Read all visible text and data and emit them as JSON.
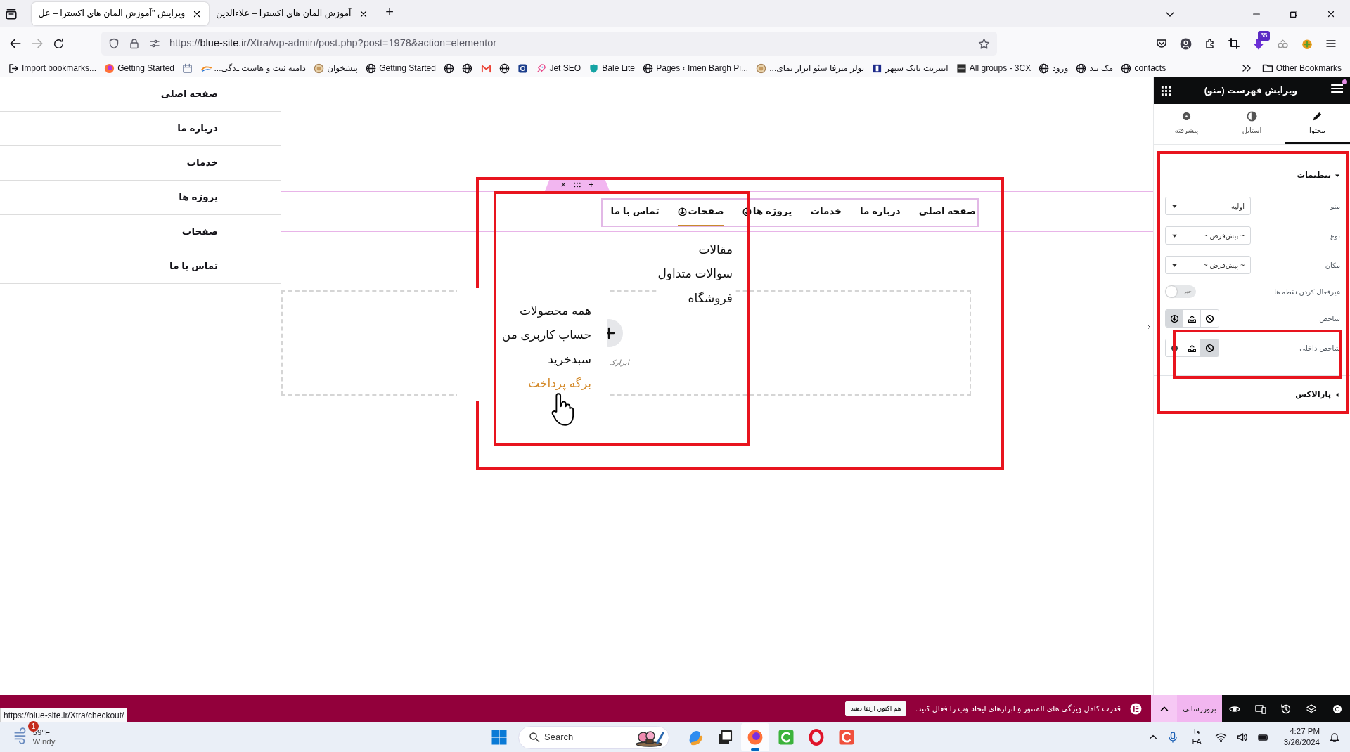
{
  "browser": {
    "tabs": [
      {
        "title": "آموزش المان های اکسترا – علاءالدین",
        "selected": false
      },
      {
        "title": "ویرایش \"آموزش المان های اکسترا – عل",
        "selected": true
      }
    ],
    "new_tab": "+",
    "url": "https://**blue-site.ir**/Xtra/wp-admin/post.php?post=1978&action=elementor",
    "extension_badge": "35",
    "bookmarks": [
      {
        "kind": "globe",
        "label": "contacts"
      },
      {
        "kind": "globe",
        "label": "مک نید"
      },
      {
        "kind": "globe",
        "label": "ورود"
      },
      {
        "kind": "cx",
        "label": "All groups - 3CX"
      },
      {
        "kind": "bank",
        "label": "اینترنت بانک سپهر"
      },
      {
        "kind": "lion",
        "label": "تولز میزفا سئو ابزار نمای..."
      },
      {
        "kind": "globe",
        "label": "Pages ‹ Imen Bargh Pi..."
      },
      {
        "kind": "shield",
        "label": "Bale Lite"
      },
      {
        "kind": "rocket",
        "label": "Jet SEO"
      },
      {
        "kind": "square"
      },
      {
        "kind": "globe"
      },
      {
        "kind": "mail"
      },
      {
        "kind": "globe"
      },
      {
        "kind": "globe"
      },
      {
        "kind": "globe",
        "label": "Getting Started"
      },
      {
        "kind": "lion",
        "label": "پیشخوان"
      },
      {
        "kind": "swoosh",
        "label": "دامنه ثبت و هاست ـدگی..."
      },
      {
        "kind": "calendar"
      },
      {
        "kind": "fox",
        "label": "Getting Started"
      },
      {
        "kind": "import",
        "label": "Import bookmarks..."
      }
    ],
    "other_bookmarks": "Other Bookmarks"
  },
  "page_menu": [
    "صفحه اصلی",
    "درباره ما",
    "خدمات",
    "پروژه ها",
    "صفحات",
    "تماس با ما"
  ],
  "canvas": {
    "handle": {
      "close": "×",
      "add": "+"
    },
    "nav": [
      {
        "label": "صفحه اصلی",
        "dropdown": false,
        "selected": false
      },
      {
        "label": "درباره ما",
        "dropdown": false,
        "selected": false
      },
      {
        "label": "خدمات",
        "dropdown": false,
        "selected": false
      },
      {
        "label": "پروژه ها",
        "dropdown": true,
        "selected": false
      },
      {
        "label": "صفحات",
        "dropdown": true,
        "selected": true,
        "expanded": true,
        "children": [
          {
            "label": "مقالات",
            "hovered": false
          },
          {
            "label": "سوالات متداول",
            "hovered": false
          },
          {
            "label": "فروشگاه",
            "hovered": false,
            "expanded": true,
            "children": [
              {
                "label": "همه محصولات",
                "hovered": false
              },
              {
                "label": "حساب کاربری من",
                "hovered": false
              },
              {
                "label": "سبدخرید",
                "hovered": false
              },
              {
                "label": "برگه پرداخت",
                "hovered": true
              }
            ]
          }
        ]
      },
      {
        "label": "تماس با ما",
        "dropdown": false,
        "selected": false
      }
    ],
    "empty_section": {
      "add_label": "ابزارک"
    }
  },
  "panel": {
    "title": "ویرایش فهرست (منو)",
    "notification": true,
    "tabs": [
      {
        "label": "محتوا",
        "kind": "pencil",
        "selected": true
      },
      {
        "label": "استایل",
        "kind": "contrast",
        "selected": false
      },
      {
        "label": "پیشرفته",
        "kind": "gear",
        "selected": false
      }
    ],
    "sections": [
      {
        "title": "تنظیمات",
        "expanded": true,
        "controls": [
          {
            "kind": "select",
            "label": "منو",
            "value": "اولیه"
          },
          {
            "kind": "select",
            "label": "نوع",
            "value": "~ پیش‌فرض ~"
          },
          {
            "kind": "select",
            "label": "مکان",
            "value": "~ پیش‌فرض ~"
          },
          {
            "kind": "toggle",
            "label": "غیرفعال کردن نقطه ها",
            "on": false,
            "off_text": "خیر"
          },
          {
            "kind": "choose",
            "label": "شاخص",
            "options": [
              {
                "kind": "arrow",
                "selected": true
              },
              {
                "kind": "upload",
                "selected": false
              },
              {
                "kind": "none",
                "selected": false
              }
            ]
          },
          {
            "kind": "choose",
            "label": "شاخص داخلی",
            "options": [
              {
                "kind": "dot",
                "selected": false
              },
              {
                "kind": "upload",
                "selected": false
              },
              {
                "kind": "none",
                "selected": true
              }
            ]
          }
        ]
      },
      {
        "title": "پارالاکس",
        "expanded": false
      }
    ]
  },
  "editor_bar": {
    "update_button": "بروزرسانی",
    "promo_text": "قدرت کامل ویژگی های المنتور و ابزارهای ایجاد وب را فعال کنید.",
    "promo_button": "هم اکنون ارتقا دهید"
  },
  "status_url": "https://blue-site.ir/Xtra/checkout/",
  "taskbar": {
    "weather_badge": "1",
    "temperature": "59°F",
    "condition": "Windy",
    "search": "Search",
    "apps": [
      {
        "kind": "copilot",
        "active": false
      },
      {
        "kind": "windows",
        "active": false
      },
      {
        "kind": "fox",
        "active": true
      },
      {
        "kind": "greenc",
        "active": false
      },
      {
        "kind": "ring",
        "active": false
      },
      {
        "kind": "redc",
        "active": false
      }
    ],
    "language_script": "فا",
    "language": "FA",
    "time": "4:27 PM",
    "date": "3/26/2024"
  }
}
